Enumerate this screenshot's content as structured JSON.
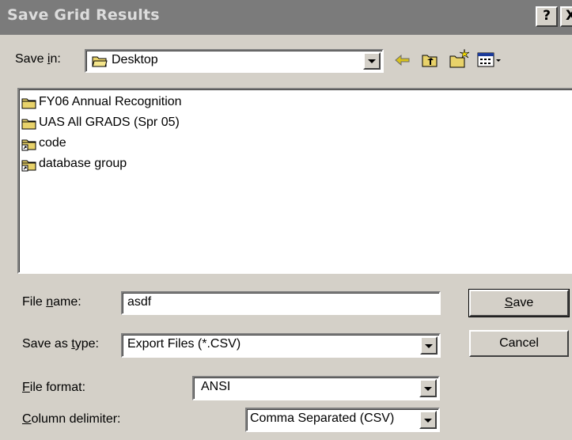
{
  "window": {
    "title": "Save Grid Results",
    "help_label": "?",
    "close_label": "X"
  },
  "toolbar": {
    "save_in_label_pre": "Save ",
    "save_in_label_key": "i",
    "save_in_label_post": "n:",
    "location": "Desktop",
    "icons": [
      "back-arrow-icon",
      "up-folder-icon",
      "new-folder-icon",
      "view-menu-icon"
    ]
  },
  "files": [
    {
      "name": "FY06 Annual Recognition",
      "icon": "folder-icon"
    },
    {
      "name": "UAS All GRADS (Spr 05)",
      "icon": "folder-icon"
    },
    {
      "name": "code",
      "icon": "folder-shortcut-icon"
    },
    {
      "name": "database group",
      "icon": "folder-shortcut-icon"
    }
  ],
  "form": {
    "file_name": {
      "label_pre": "File ",
      "label_key": "n",
      "label_post": "ame:",
      "value": "asdf"
    },
    "save_as_type": {
      "label_pre": "Save as ",
      "label_key": "t",
      "label_post": "ype:",
      "value": "Export Files (*.CSV)"
    },
    "file_format": {
      "label_key": "F",
      "label_post": "ile format:",
      "value": "ANSI"
    },
    "column_delimiter": {
      "label_key": "C",
      "label_post": "olumn delimiter:",
      "value": "Comma Separated (CSV)"
    }
  },
  "buttons": {
    "save_key": "S",
    "save_rest": "ave",
    "cancel": "Cancel"
  },
  "colors": {
    "face": "#d4d0c8",
    "titlebar": "#7b7b7b",
    "folder": "#e8d26a"
  }
}
